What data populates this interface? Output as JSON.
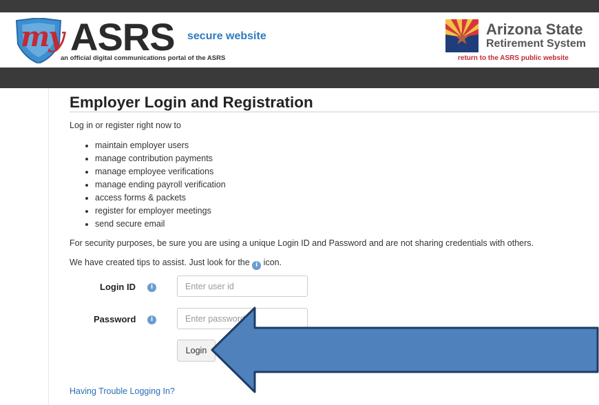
{
  "header": {
    "logo_my": "my",
    "logo_asrs": "ASRS",
    "logo_secure": "secure website",
    "logo_tagline": "an official digital communications portal of the ASRS",
    "org_title": "Arizona State",
    "org_subtitle": "Retirement System",
    "return_link": "return to the ASRS public website"
  },
  "page": {
    "title": "Employer Login and Registration",
    "intro": "Log in or register right now to",
    "features": [
      "maintain employer users",
      "manage contribution payments",
      "manage employee verifications",
      "manage ending payroll verification",
      "access forms & packets",
      "register for employer meetings",
      "send secure email"
    ],
    "security_note": "For security purposes, be sure you are using a unique Login ID and Password and are not sharing credentials with others.",
    "tips_before": "We have created tips to assist. Just look for the",
    "tips_after": "icon."
  },
  "form": {
    "login_id_label": "Login ID",
    "login_id_placeholder": "Enter user id",
    "login_id_value": "",
    "password_label": "Password",
    "password_placeholder": "Enter password",
    "password_value": "",
    "info_glyph": "i",
    "login_button": "Login",
    "trouble_link": "Having Trouble Logging In?"
  },
  "icons": {
    "info": "info-icon",
    "logo": "asrs-shield-logo",
    "state": "arizona-flag-logo",
    "callout": "arrow-pointer"
  },
  "colors": {
    "brand_red": "#c22a33",
    "brand_blue": "#2e7bbf",
    "link_blue": "#2a6eb5",
    "bar_dark": "#3a3a3a",
    "arrow_fill": "#4f81bd",
    "arrow_stroke": "#1f3c63"
  }
}
